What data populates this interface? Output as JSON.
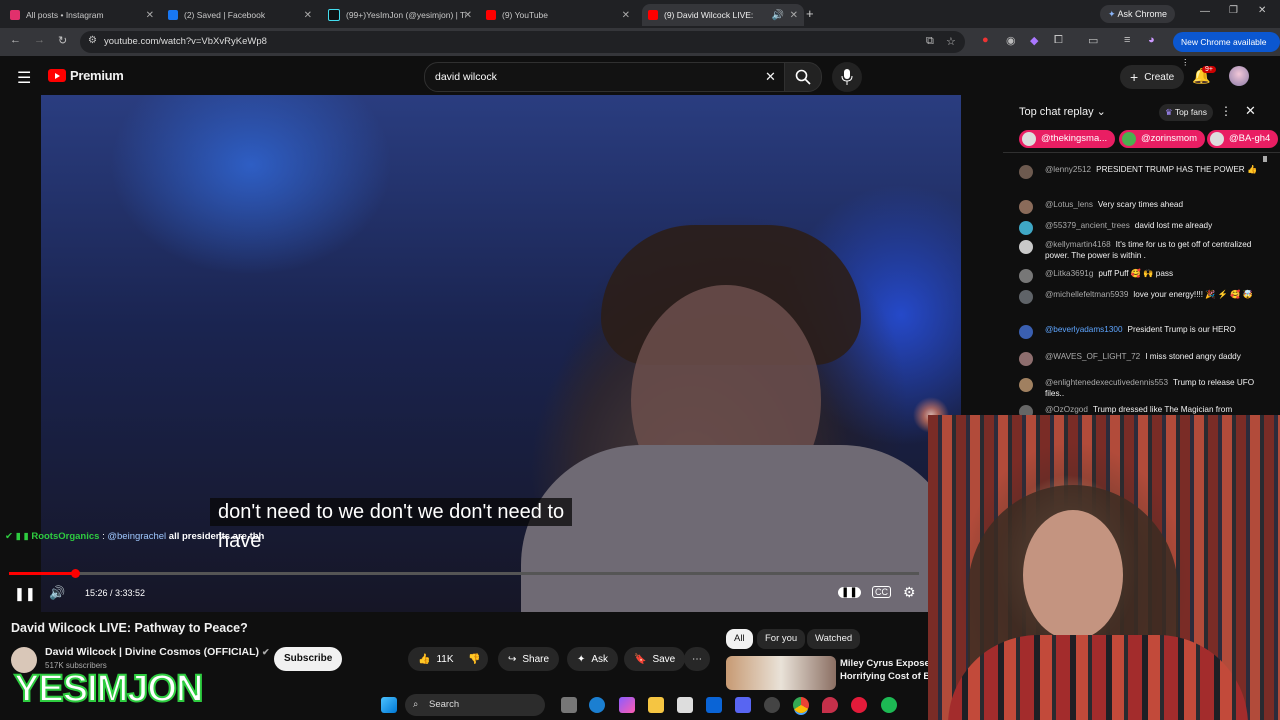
{
  "tabs": [
    {
      "label": "All posts • Instagram",
      "color": "#e1306c"
    },
    {
      "label": "(2) Saved | Facebook",
      "color": "#1877f2"
    },
    {
      "label": "(99+)YesImJon (@yesimjon) | Ti",
      "color": "#111111"
    },
    {
      "label": "(9) YouTube",
      "color": "#ff0000"
    },
    {
      "label": "(9) David Wilcock LIVE: Path",
      "color": "#ff0000"
    }
  ],
  "browser": {
    "ask_chrome": "Ask Chrome",
    "url": "youtube.com/watch?v=VbXvRyKeWp8",
    "new_chrome": "New Chrome available"
  },
  "youtube": {
    "logo_text": "Premium",
    "search_value": "david wilcock",
    "create_label": "Create",
    "notification_badge": "9+"
  },
  "player": {
    "caption_line1": "don't need to we don't we don't need to",
    "caption_line2": "have",
    "overlay_user": "RootsOrganics",
    "overlay_mention": "@beingrachel",
    "overlay_text": "all presidents are tbh",
    "time_display": "15:26 / 3:33:52",
    "progress_fraction": 0.072
  },
  "video": {
    "title": "David Wilcock LIVE: Pathway to Peace?",
    "channel": "David Wilcock | Divine Cosmos (OFFICIAL)",
    "subscribers": "517K subscribers",
    "subscribe_label": "Subscribe",
    "likes": "11K",
    "share_label": "Share",
    "ask_label": "Ask",
    "save_label": "Save"
  },
  "chips": [
    "All",
    "For you",
    "Watched"
  ],
  "recommended": {
    "title_line1": "Miley Cyrus Exposes",
    "title_line2": "Horrifying Cost of Be"
  },
  "chat": {
    "mode": "Top chat replay",
    "top_fans": "Top fans",
    "donors": [
      {
        "name": "@thekingsma...",
        "color": "#e91e63"
      },
      {
        "name": "@zorinsmom",
        "color": "#e91e63"
      },
      {
        "name": "@BA-gh4",
        "color": "#e91e63"
      }
    ],
    "messages": [
      {
        "author": "@lenny2512",
        "text": "PRESIDENT TRUMP HAS THE POWER 👍",
        "avatar": "#6d5a4f"
      },
      {
        "author": "@Lotus_lens",
        "text": "Very scary times ahead",
        "avatar": "#8a6b5a"
      },
      {
        "author": "@55379_ancient_trees",
        "text": "david lost me already",
        "avatar": "#3fa7c5"
      },
      {
        "author": "@kellymartin4168",
        "text": "It's time for us to get off of centralized power. The power is within .",
        "avatar": "#c9c9c9"
      },
      {
        "author": "@Litka3691g",
        "text": "puff Puff 🥰 🙌 pass",
        "avatar": "#777777"
      },
      {
        "author": "@michellefeltman5939",
        "text": "love your energy!!!! 🎉 ⚡ 🥰 🤯",
        "avatar": "#5f6368"
      },
      {
        "author": "@beverlyadams1300",
        "text": "President Trump is our HERO",
        "avatar": "#3a5fb0"
      },
      {
        "author": "@WAVES_OF_LIGHT_72",
        "text": "I miss stoned angry daddy",
        "avatar": "#8e6e6e"
      },
      {
        "author": "@enlightenedexecutivedennis553",
        "text": "Trump to release UFO files..",
        "avatar": "#a08060"
      },
      {
        "author": "@OzOzgod",
        "text": "Trump dressed like The Magician from",
        "avatar": "#666666"
      }
    ]
  },
  "watermark": "YESIMJON",
  "taskbar": {
    "search_label": "Search"
  }
}
